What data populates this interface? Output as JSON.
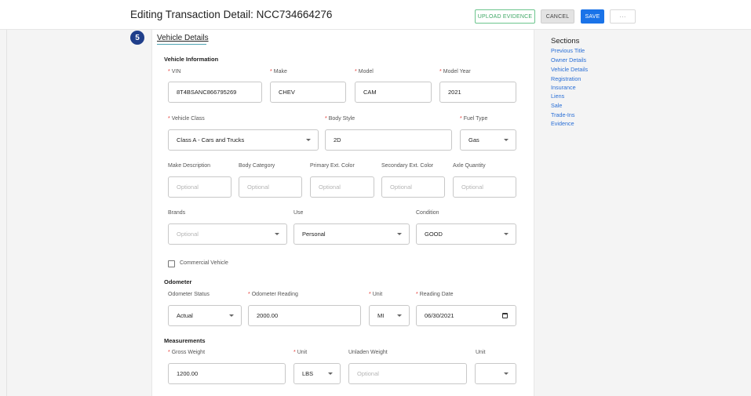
{
  "header": {
    "title": "Editing Transaction Detail: NCC734664276",
    "upload_label": "UPLOAD EVIDENCE",
    "cancel_label": "CANCEL",
    "save_label": "SAVE",
    "more_label": "···"
  },
  "section": {
    "number": "5",
    "title": "Vehicle Details"
  },
  "vehicle_info": {
    "heading": "Vehicle Information",
    "vin": {
      "label": "VIN",
      "value": "8T4BSANC866795269"
    },
    "make": {
      "label": "Make",
      "value": "CHEV"
    },
    "model": {
      "label": "Model",
      "value": "CAM"
    },
    "model_year": {
      "label": "Model Year",
      "value": "2021"
    },
    "vehicle_class": {
      "label": "Vehicle Class",
      "value": "Class A - Cars and Trucks"
    },
    "body_style": {
      "label": "Body Style",
      "value": "2D"
    },
    "fuel_type": {
      "label": "Fuel Type",
      "value": "Gas"
    },
    "make_description": {
      "label": "Make Description",
      "placeholder": "Optional"
    },
    "body_category": {
      "label": "Body Category",
      "placeholder": "Optional"
    },
    "primary_color": {
      "label": "Primary Ext. Color",
      "placeholder": "Optional"
    },
    "secondary_color": {
      "label": "Secondary Ext. Color",
      "placeholder": "Optional"
    },
    "axle_quantity": {
      "label": "Axle Quantity",
      "placeholder": "Optional"
    },
    "brands": {
      "label": "Brands",
      "placeholder": "Optional"
    },
    "use": {
      "label": "Use",
      "value": "Personal"
    },
    "condition": {
      "label": "Condition",
      "value": "GOOD"
    },
    "commercial_vehicle_label": "Commercial Vehicle"
  },
  "odometer": {
    "heading": "Odometer",
    "status": {
      "label": "Odometer Status",
      "value": "Actual"
    },
    "reading": {
      "label": "Odometer Reading",
      "value": "2000.00"
    },
    "unit": {
      "label": "Unit",
      "value": "MI"
    },
    "reading_date": {
      "label": "Reading Date",
      "value": "06/30/2021"
    }
  },
  "measurements": {
    "heading": "Measurements",
    "gross_weight": {
      "label": "Gross Weight",
      "value": "1200.00"
    },
    "unit": {
      "label": "Unit",
      "value": "LBS"
    },
    "unladen_weight": {
      "label": "Unladen Weight",
      "placeholder": "Optional"
    },
    "unit2": {
      "label": "Unit",
      "value": ""
    }
  },
  "sidebar": {
    "heading": "Sections",
    "items": [
      "Previous Title",
      "Owner Details",
      "Vehicle Details",
      "Registration",
      "Insurance",
      "Liens",
      "Sale",
      "Trade-Ins",
      "Evidence"
    ]
  },
  "colors": {
    "accent": "#1a73e8",
    "badge": "#1f3e8a",
    "upload": "#3fa866",
    "required": "#e53935",
    "link": "#2a6fd6"
  }
}
